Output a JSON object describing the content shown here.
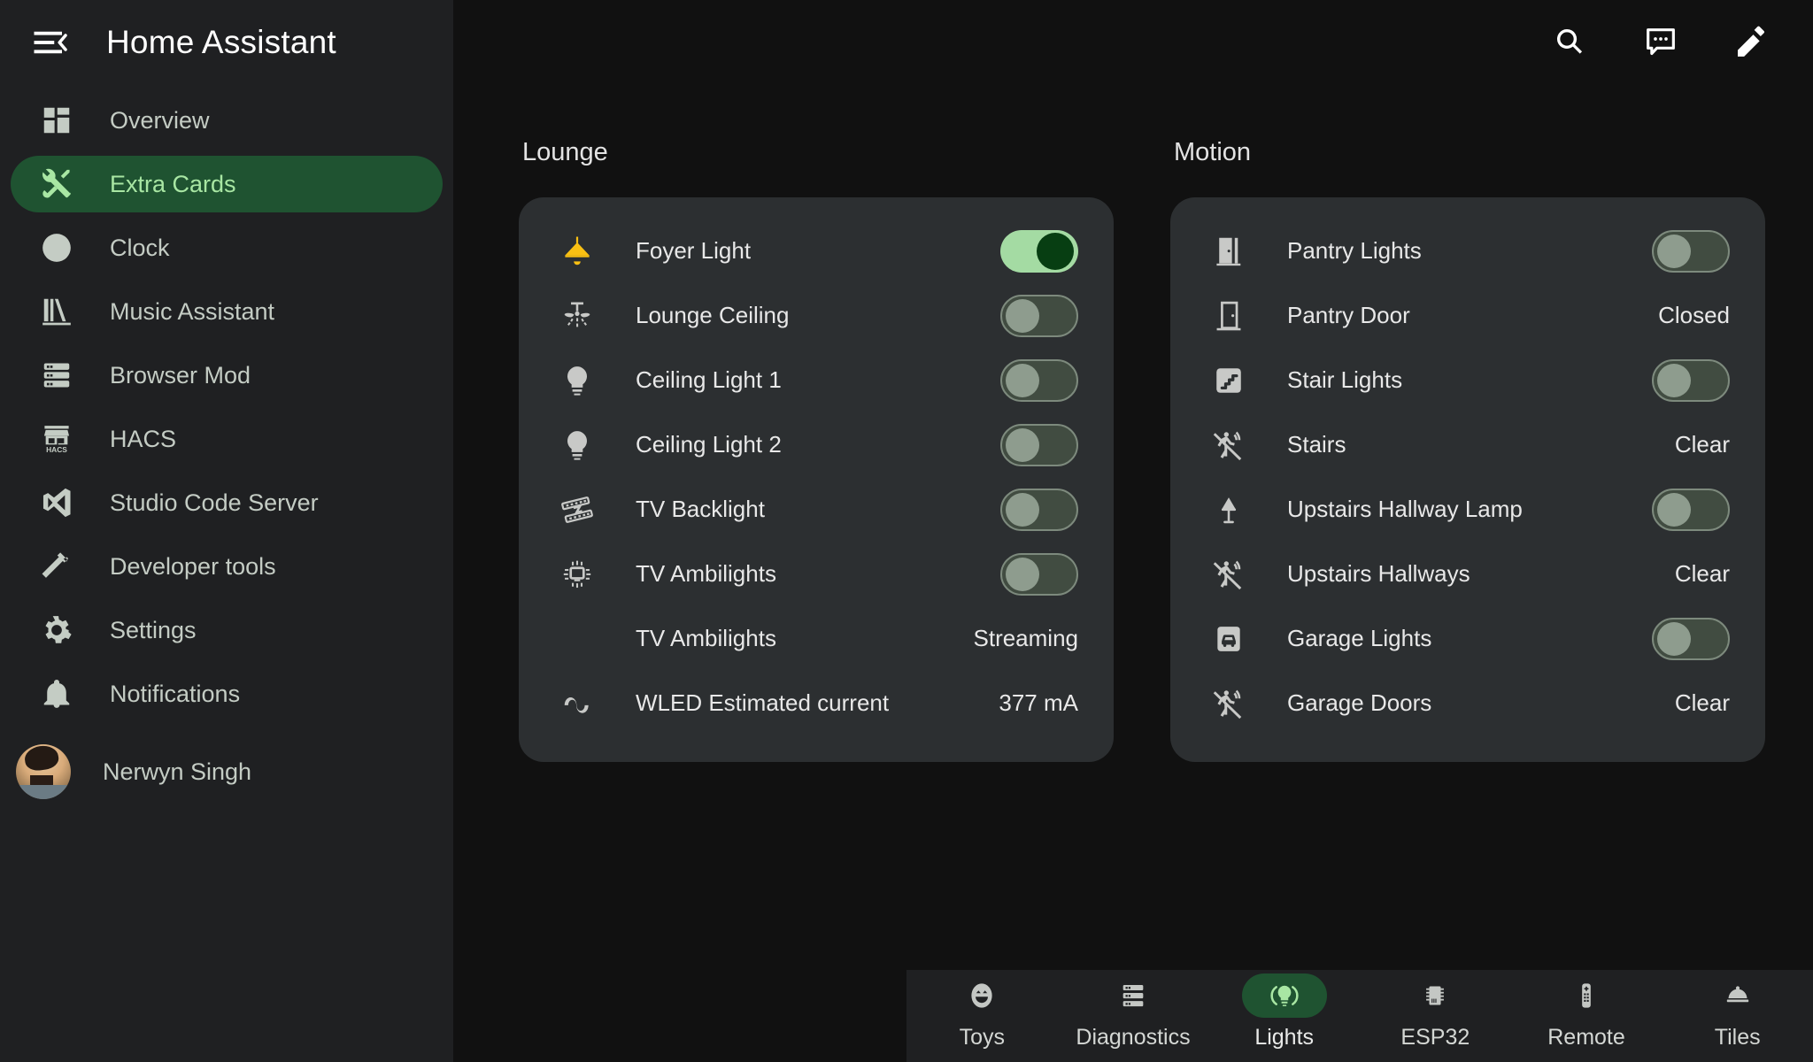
{
  "sidebar": {
    "title": "Home Assistant",
    "menu_icon": "menu-collapse-icon",
    "items": [
      {
        "label": "Overview",
        "icon": "view-dashboard-icon",
        "active": false
      },
      {
        "label": "Extra Cards",
        "icon": "tools-icon",
        "active": true
      },
      {
        "label": "Clock",
        "icon": "clock-icon",
        "active": false
      },
      {
        "label": "Music Assistant",
        "icon": "bookshelf-icon",
        "active": false
      },
      {
        "label": "Browser Mod",
        "icon": "server-icon",
        "active": false
      },
      {
        "label": "HACS",
        "icon": "hacs-storefront-icon",
        "active": false
      },
      {
        "label": "Studio Code Server",
        "icon": "vscode-icon",
        "active": false
      },
      {
        "label": "Developer tools",
        "icon": "hammer-icon",
        "active": false
      },
      {
        "label": "Settings",
        "icon": "gear-icon",
        "active": false
      },
      {
        "label": "Notifications",
        "icon": "bell-icon",
        "active": false
      }
    ],
    "user": {
      "name": "Nerwyn Singh",
      "avatar": "user-avatar"
    }
  },
  "topbar": {
    "buttons": [
      {
        "name": "search-button",
        "icon": "search-icon"
      },
      {
        "name": "assist-button",
        "icon": "comment-dots-icon"
      },
      {
        "name": "edit-dashboard-button",
        "icon": "pencil-icon"
      }
    ]
  },
  "columns": [
    {
      "heading": "Lounge",
      "rows": [
        {
          "name": "Foyer Light",
          "icon": "ceiling-light-icon",
          "icon_color": "amber",
          "control": "toggle",
          "state": "on"
        },
        {
          "name": "Lounge Ceiling",
          "icon": "ceiling-fan-light-icon",
          "icon_color": "default",
          "control": "toggle",
          "state": "off"
        },
        {
          "name": "Ceiling Light 1",
          "icon": "lightbulb-icon",
          "icon_color": "default",
          "control": "toggle",
          "state": "off"
        },
        {
          "name": "Ceiling Light 2",
          "icon": "lightbulb-icon",
          "icon_color": "default",
          "control": "toggle",
          "state": "off"
        },
        {
          "name": "TV Backlight",
          "icon": "led-strip-icon",
          "icon_color": "default",
          "control": "toggle",
          "state": "off"
        },
        {
          "name": "TV Ambilights",
          "icon": "television-ambient-light-icon",
          "icon_color": "default",
          "control": "toggle",
          "state": "off"
        },
        {
          "name": "TV Ambilights",
          "icon": "none",
          "icon_color": "default",
          "control": "value",
          "value": "Streaming"
        },
        {
          "name": "WLED Estimated current",
          "icon": "sine-wave-icon",
          "icon_color": "default",
          "control": "value",
          "value": "377 mA"
        }
      ]
    },
    {
      "heading": "Motion",
      "rows": [
        {
          "name": "Pantry Lights",
          "icon": "door-open-icon",
          "icon_color": "default",
          "control": "toggle",
          "state": "off"
        },
        {
          "name": "Pantry Door",
          "icon": "door-closed-icon",
          "icon_color": "default",
          "control": "value",
          "value": "Closed"
        },
        {
          "name": "Stair Lights",
          "icon": "stairs-icon",
          "icon_color": "default",
          "control": "toggle",
          "state": "off"
        },
        {
          "name": "Stairs",
          "icon": "motion-sensor-off-icon",
          "icon_color": "default",
          "control": "value",
          "value": "Clear"
        },
        {
          "name": "Upstairs Hallway Lamp",
          "icon": "lamp-icon",
          "icon_color": "default",
          "control": "toggle",
          "state": "off"
        },
        {
          "name": "Upstairs Hallways",
          "icon": "motion-sensor-off-icon",
          "icon_color": "default",
          "control": "value",
          "value": "Clear"
        },
        {
          "name": "Garage Lights",
          "icon": "garage-icon",
          "icon_color": "default",
          "control": "toggle",
          "state": "off"
        },
        {
          "name": "Garage Doors",
          "icon": "motion-sensor-off-icon",
          "icon_color": "default",
          "control": "value",
          "value": "Clear"
        }
      ]
    }
  ],
  "bottom_nav": [
    {
      "label": "Toys",
      "icon": "emoticon-icon",
      "active": false
    },
    {
      "label": "Diagnostics",
      "icon": "server-icon",
      "active": false
    },
    {
      "label": "Lights",
      "icon": "lightbulb-on-icon",
      "active": true
    },
    {
      "label": "ESP32",
      "icon": "chip-icon",
      "active": false
    },
    {
      "label": "Remote",
      "icon": "remote-icon",
      "active": false
    },
    {
      "label": "Tiles",
      "icon": "dome-light-icon",
      "active": false
    }
  ],
  "colors": {
    "page_background": "#111111",
    "sidebar_background": "#1f2022",
    "card_background": "#2c2f31",
    "accent_green": "#1f5331",
    "accent_green_text": "#a8e6a3",
    "toggle_on_track": "#a4dba3",
    "toggle_on_knob": "#073e12",
    "toggle_off_track": "#414c41",
    "toggle_off_knob": "#8e9c8e",
    "amber_icon": "#f9c013",
    "primary_text": "#e8e8e8",
    "secondary_text": "#c4ccc4"
  }
}
